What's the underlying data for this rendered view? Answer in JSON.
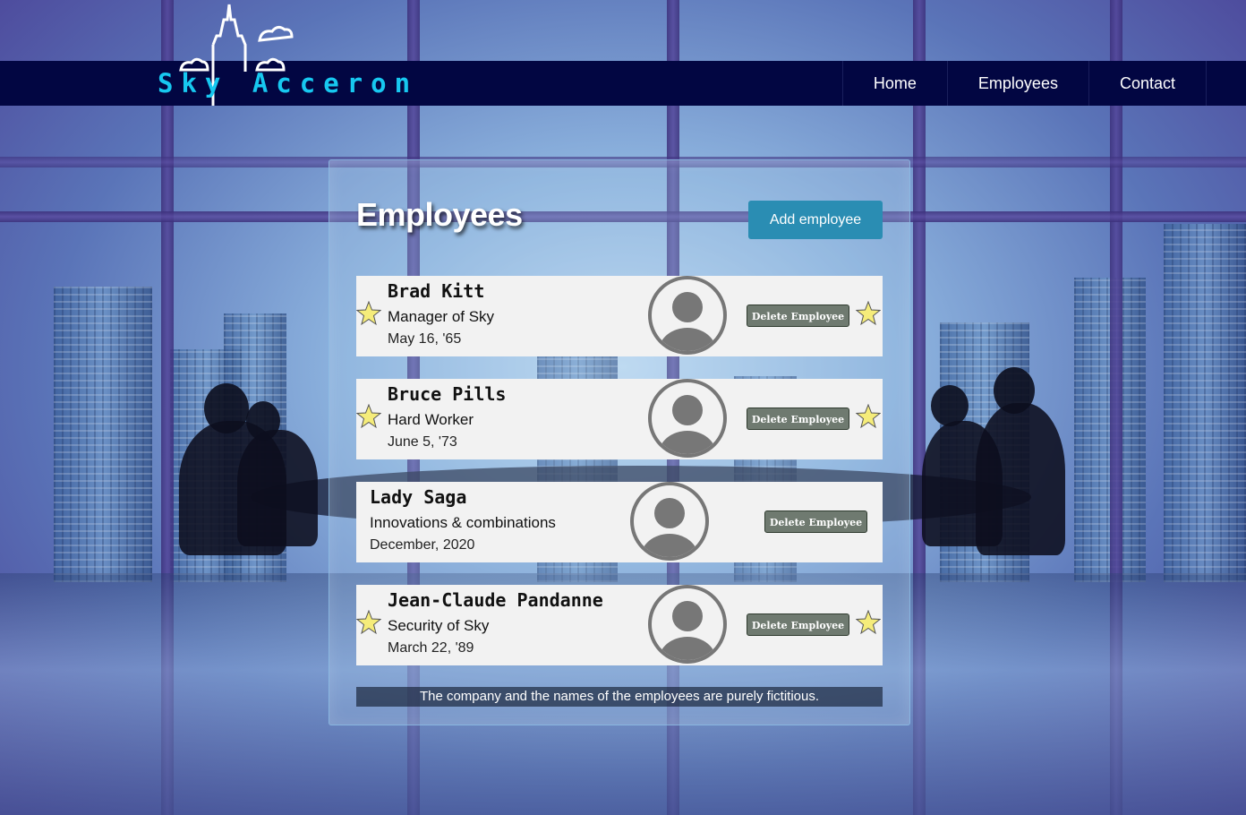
{
  "brand": {
    "name": "Sky Acceron",
    "text_color": "#17c8f0"
  },
  "navbar": {
    "background": "#020642",
    "links": [
      {
        "label": "Home"
      },
      {
        "label": "Employees"
      },
      {
        "label": "Contact"
      }
    ]
  },
  "panel": {
    "title": "Employees",
    "add_button": "Add employee"
  },
  "employees": [
    {
      "name": "Brad Kitt",
      "role": "Manager of Sky",
      "date": "May 16, '65",
      "starred": true,
      "delete_label": "Delete Employee",
      "avatar_icon": "user-avatar-icon"
    },
    {
      "name": "Bruce Pills",
      "role": "Hard Worker",
      "date": "June 5, '73",
      "starred": true,
      "delete_label": "Delete Employee",
      "avatar_icon": "user-avatar-icon"
    },
    {
      "name": "Lady Saga",
      "role": "Innovations & combinations",
      "date": "December, 2020",
      "starred": false,
      "delete_label": "Delete Employee",
      "avatar_icon": "user-avatar-icon"
    },
    {
      "name": "Jean-Claude Pandanne",
      "role": "Security of Sky",
      "date": "March 22, '89",
      "starred": true,
      "delete_label": "Delete Employee",
      "avatar_icon": "user-avatar-icon"
    }
  ],
  "footer_note": "The company and the names of the employees are purely fictitious.",
  "colors": {
    "add_button": "#2a8db3",
    "delete_button": "#6f7a70",
    "star": "#f5ec7a"
  }
}
